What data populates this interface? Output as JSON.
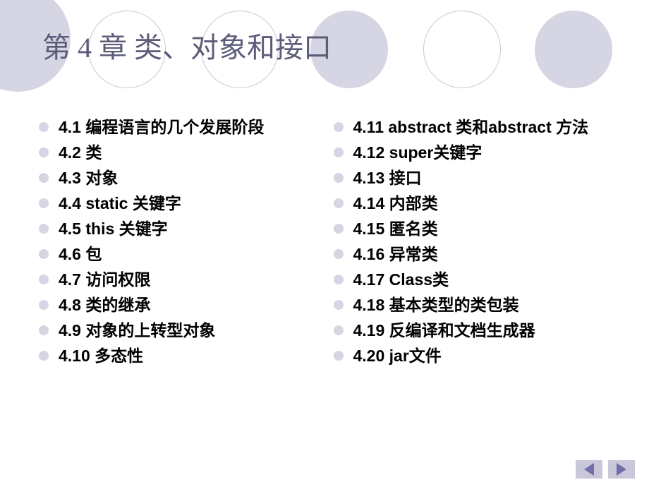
{
  "title": "第 4 章   类、对象和接口",
  "left_items": [
    "4.1 编程语言的几个发展阶段",
    "4.2 类",
    "4.3 对象",
    "4.4 static 关键字",
    "4.5 this 关键字",
    "4.6 包",
    "4.7 访问权限",
    "4.8 类的继承",
    "4.9 对象的上转型对象",
    "4.10 多态性"
  ],
  "right_items": [
    "4.11 abstract 类和abstract 方法",
    "4.12 super关键字",
    "4.13 接口",
    "4.14 内部类",
    "4.15 匿名类",
    "4.16 异常类",
    "4.17 Class类",
    "4.18 基本类型的类包装",
    "4.19 反编译和文档生成器",
    "4.20 jar文件"
  ]
}
